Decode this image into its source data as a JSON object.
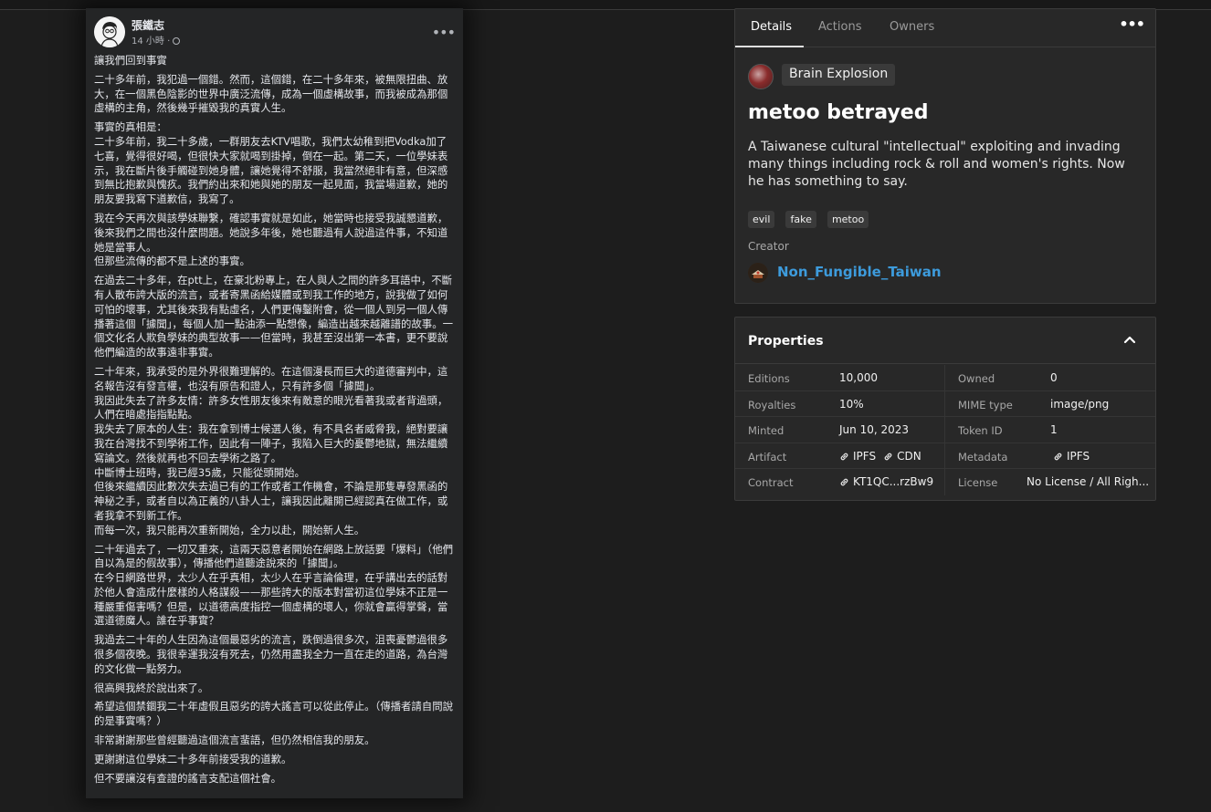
{
  "post": {
    "author": "張鐵志",
    "meta": "14 小時 · ",
    "paragraphs": [
      "讓我們回到事實",
      "二十多年前，我犯過一個錯。然而，這個錯，在二十多年來，被無限扭曲、放大，在一個黑色陰影的世界中廣泛流傳，成為一個虛構故事，而我被成為那個虛構的主角，然後幾乎摧毀我的真實人生。",
      "事實的真相是：\n二十多年前，我二十多歲，一群朋友去KTV唱歌，我們太幼稚到把Vodka加了七喜，覺得很好喝，但很快大家就喝到掛掉，倒在一起。第二天，一位學妹表示，我在斷片後手觸碰到她身體，讓她覺得不舒服，我當然絕非有意，但深感到無比抱歉與愧疚。我們約出來和她與她的朋友一起見面，我當場道歉，她的朋友要我寫下道歉信，我寫了。",
      "我在今天再次與該學妹聯繫，確認事實就是如此，她當時也接受我誠懇道歉，後來我們之間也沒什麼問題。她說多年後，她也聽過有人說過這件事，不知道她是當事人。\n但那些流傳的都不是上述的事實。",
      "在過去二十多年，在ptt上，在豪北粉專上，在人與人之間的許多耳語中，不斷有人散布誇大版的流言，或者寄黑函給媒體或到我工作的地方，說我做了如何可怕的壞事，尤其後來我有點虛名，人們更傳鑿附會，從一個人到另一個人傳播著這個「據聞」，每個人加一點油添一點想像，編造出越來越離譜的故事。一個文化名人欺負學妹的典型故事——但當時，我甚至沒出第一本書，更不要說他們編造的故事遠非事實。",
      "二十年來，我承受的是外界很難理解的。在這個漫長而巨大的道德審判中，這名報告沒有發言權，也沒有原告和證人，只有許多個「據聞」。\n我因此失去了許多友情：許多女性朋友後來有敵意的眼光看著我或者背過頭，人們在暗處指指點點。\n我失去了原本的人生：我在拿到博士候選人後，有不具名者威脅我，絕對要讓我在台灣找不到學術工作，因此有一陣子，我陷入巨大的憂鬱地獄，無法繼續寫論文。然後就再也不回去學術之路了。\n中斷博士班時，我已經35歲，只能從頭開始。\n但後來繼續因此數次失去過已有的工作或者工作機會，不論是那隻專發黑函的神秘之手，或者自以為正義的八卦人士，讓我因此離開已經認真在做工作，或者我拿不到新工作。\n而每一次，我只能再次重新開始，全力以赴，開始新人生。",
      "二十年過去了，一切又重來，這兩天惡意者開始在網路上放話要「爆料」（他們自以為是的假故事），傳播他們道聽途說來的「據聞」。\n在今日網路世界，太少人在乎真相，太少人在乎言論倫理，在乎講出去的話對於他人會造成什麼樣的人格謀殺——那些誇大的版本對當初這位學妹不正是一種嚴重傷害嗎？但是，以道德高度指控一個虛構的壞人，你就會贏得掌聲，當選道德魔人。誰在乎事實？",
      "我過去二十年的人生因為這個最惡劣的流言，跌倒過很多次，沮喪憂鬱過很多很多個夜晚。我很幸運我沒有死去，仍然用盡我全力一直在走的道路，為台灣的文化做一點努力。",
      "很高興我終於說出來了。",
      "希望這個禁錮我二十年虛假且惡劣的誇大謠言可以從此停止。（傳播者請自問說的是事實嗎？）",
      "非常謝謝那些曾經聽過這個流言蜚語，但仍然相信我的朋友。",
      "更謝謝這位學妹二十多年前接受我的道歉。",
      "但不要讓沒有查證的謠言支配這個社會。"
    ]
  },
  "tabs": [
    "Details",
    "Actions",
    "Owners"
  ],
  "details": {
    "collection": "Brain Explosion",
    "title": "metoo betrayed",
    "description": "A Taiwanese cultural \"intellectual\" exploiting and invading many things including rock & roll and women's rights. Now he has something to say.",
    "tags": [
      "evil",
      "fake",
      "metoo"
    ],
    "creator_label": "Creator",
    "creator": "Non_Fungible_Taiwan"
  },
  "properties": {
    "title": "Properties",
    "rows": [
      {
        "k1": "Editions",
        "v1": "10,000",
        "k2": "Owned",
        "v2": "0"
      },
      {
        "k1": "Royalties",
        "v1": "10%",
        "k2": "MIME type",
        "v2": "image/png"
      },
      {
        "k1": "Minted",
        "v1": "Jun 10, 2023",
        "k2": "Token ID",
        "v2": "1"
      },
      {
        "k1": "Artifact",
        "links1": [
          "IPFS",
          "CDN"
        ],
        "k2": "Metadata",
        "links2": [
          "IPFS"
        ]
      },
      {
        "k1": "Contract",
        "links1": [
          "KT1QC...rzBw9"
        ],
        "k2": "License",
        "v2": "No License / All Righ..."
      }
    ]
  },
  "colors": {
    "accent_link": "#3d9bdc",
    "panel": "#282828",
    "background": "#1d1d1d"
  },
  "icons": [
    "more-dots-icon",
    "chevron-up-icon",
    "link-icon",
    "globe-icon"
  ]
}
